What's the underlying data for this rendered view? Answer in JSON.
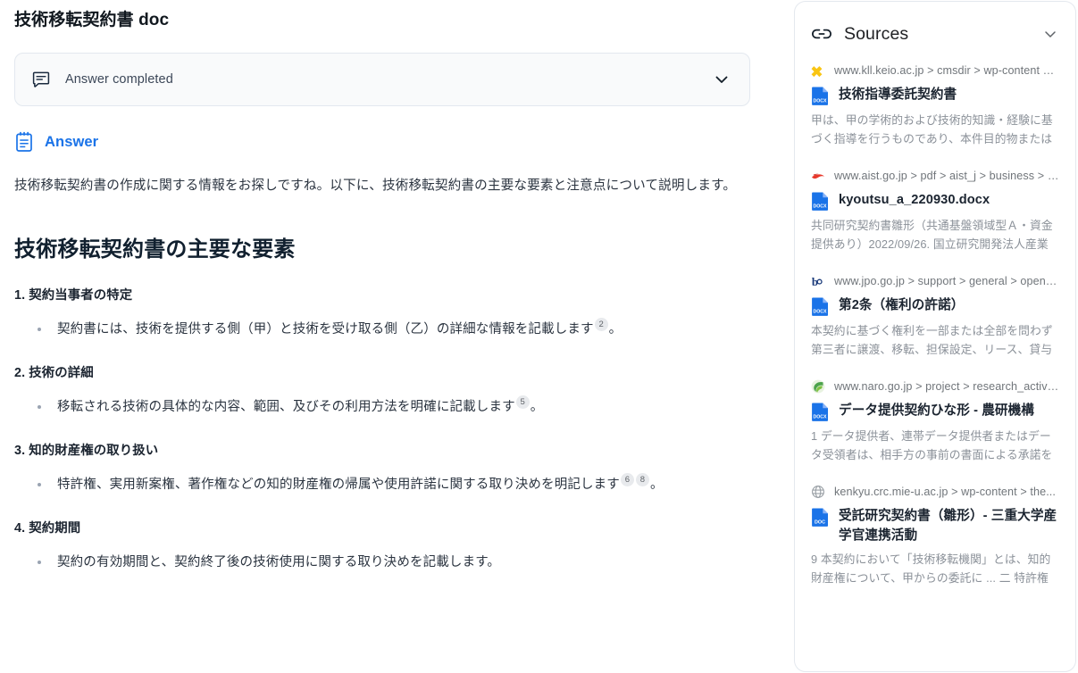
{
  "document": {
    "title": "技術移転契約書 doc"
  },
  "status_banner": {
    "icon": "chat-bubble-icon",
    "label": "Answer completed",
    "chevron": "chevron-down-icon"
  },
  "answer_section": {
    "icon": "notepad-icon",
    "label": "Answer",
    "accent_color": "#1a73e8",
    "intro": "技術移転契約書の作成に関する情報をお探しですね。以下に、技術移転契約書の主要な要素と注意点について説明します。",
    "heading": "技術移転契約書の主要な要素",
    "sections": [
      {
        "heading": "1. 契約当事者の特定",
        "bullets": [
          {
            "text_before": "契約書には、技術を提供する側（甲）と技術を受け取る側（乙）の詳細な情報を記載します",
            "citations": [
              "2"
            ],
            "text_after": "。"
          }
        ]
      },
      {
        "heading": "2. 技術の詳細",
        "bullets": [
          {
            "text_before": "移転される技術の具体的な内容、範囲、及びその利用方法を明確に記載します",
            "citations": [
              "5"
            ],
            "text_after": "。"
          }
        ]
      },
      {
        "heading": "3. 知的財産権の取り扱い",
        "bullets": [
          {
            "text_before": "特許権、実用新案権、著作権などの知的財産権の帰属や使用許諾に関する取り決めを明記します",
            "citations": [
              "6",
              "8"
            ],
            "text_after": "。"
          }
        ]
      },
      {
        "heading": "4. 契約期間",
        "bullets": [
          {
            "text_before": "契約の有効期間と、契約終了後の技術使用に関する取り決めを記載します。",
            "citations": [],
            "text_after": ""
          }
        ]
      }
    ]
  },
  "sources_panel": {
    "icon": "link-icon",
    "title": "Sources",
    "chevron": "chevron-down-icon",
    "items": [
      {
        "favicon": "sparkle-icon",
        "favicon_color": "#f9c513",
        "url": "www.kll.keio.ac.jp > cmsdir > wp-content > ...",
        "file_type": "DOCX",
        "title": "技術指導委託契約書",
        "snippet": "甲は、甲の学術的および技術的知識・経験に基づく指導を行うものであり、本件目的物または本契約..."
      },
      {
        "favicon": "aist-icon",
        "favicon_color": "#e8382c",
        "url": "www.aist.go.jp > pdf > aist_j > business > k...",
        "file_type": "DOCX",
        "title": "kyoutsu_a_220930.docx",
        "snippet": "共同研究契約書雛形（共通基盤領域型Ａ・資金提供あり）2022/09/26. 国立研究開発法人産業技術 総..."
      },
      {
        "favicon": "jpo-icon",
        "favicon_color": "#1a3a7a",
        "url": "www.jpo.go.jp > support > general > open-i...",
        "file_type": "DOCX",
        "title": "第2条（権利の許諾）",
        "snippet": "本契約に基づく権利を一部または全部を問わず第三者に譲渡、移転、担保設定、リース、貸与または..."
      },
      {
        "favicon": "naro-icon",
        "favicon_color": "#4ba24b",
        "url": "www.naro.go.jp > project > research_activiti...",
        "file_type": "DOCX",
        "title": "データ提供契約ひな形 - 農研機構",
        "snippet": "1 データ提供者、連帯データ提供者またはデータ受領者は、相手方の事前の書面による承諾を得なけ..."
      },
      {
        "favicon": "globe-icon",
        "favicon_color": "#9aa0a6",
        "url": "kenkyu.crc.mie-u.ac.jp > wp-content > the...",
        "file_type": "DOC",
        "title": "受託研究契約書（雛形）- 三重大学産学官連携活動",
        "snippet": "9 本契約において「技術移転機関」とは、知的財産権について、甲からの委託に ... 二 特許権において..."
      }
    ]
  }
}
